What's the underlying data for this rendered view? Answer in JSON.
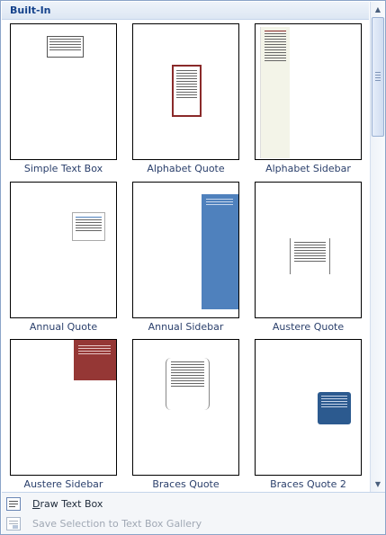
{
  "gallery": {
    "section_title": "Built-In",
    "items": [
      {
        "label": "Simple Text Box"
      },
      {
        "label": "Alphabet Quote"
      },
      {
        "label": "Alphabet Sidebar"
      },
      {
        "label": "Annual Quote"
      },
      {
        "label": "Annual Sidebar"
      },
      {
        "label": "Austere Quote"
      },
      {
        "label": "Austere Sidebar"
      },
      {
        "label": "Braces Quote"
      },
      {
        "label": "Braces Quote 2"
      }
    ]
  },
  "footer": {
    "draw_text_box": {
      "accel": "D",
      "rest": "raw Text Box"
    },
    "save_selection": {
      "label": "Save Selection to Text Box Gallery",
      "enabled": false
    }
  },
  "colors": {
    "header_text": "#15428b",
    "caption_text": "#2a3f6b",
    "alphabet_quote_border": "#8a2a2a",
    "alphabet_sidebar_fill": "#f3f4e8",
    "annual_sidebar_fill": "#4f81bd",
    "austere_sidebar_fill": "#953735",
    "braces_quote2_fill": "#2c5a8f"
  }
}
